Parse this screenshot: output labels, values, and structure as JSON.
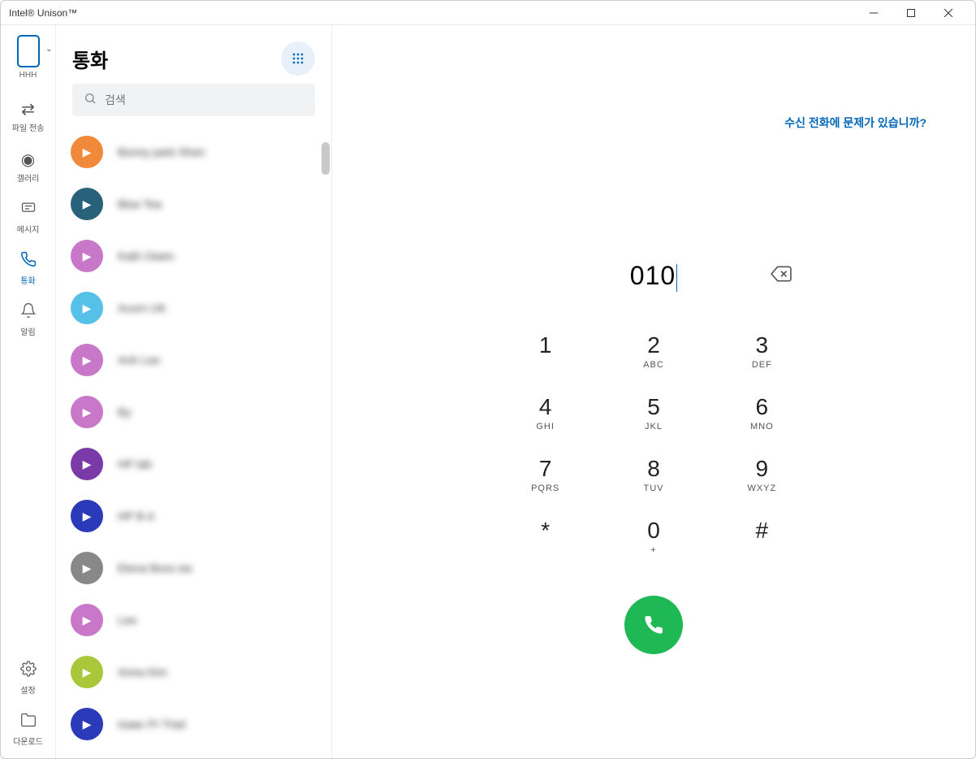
{
  "window": {
    "title": "Intel® Unison™"
  },
  "nav": {
    "device_label": "HHH",
    "items": [
      {
        "id": "file",
        "label": "파일 전송"
      },
      {
        "id": "gallery",
        "label": "갤러리"
      },
      {
        "id": "messages",
        "label": "메시지"
      },
      {
        "id": "calls",
        "label": "통화"
      },
      {
        "id": "notifications",
        "label": "알림"
      }
    ],
    "bottom": [
      {
        "id": "settings",
        "label": "설정"
      },
      {
        "id": "downloads",
        "label": "다운로드"
      }
    ],
    "active": "calls"
  },
  "contacts": {
    "title": "통화",
    "search_placeholder": "검색",
    "list": [
      {
        "name": "Bonny park Shen",
        "color": "#f08a3a"
      },
      {
        "name": "Blue Tea",
        "color": "#28627a"
      },
      {
        "name": "Kath Owen",
        "color": "#c978c9"
      },
      {
        "name": "Acorn UK",
        "color": "#55c0e8"
      },
      {
        "name": "Anh Lee",
        "color": "#c978c9"
      },
      {
        "name": "By",
        "color": "#c978c9"
      },
      {
        "name": "HP lab",
        "color": "#7a3aa8"
      },
      {
        "name": "HP B d",
        "color": "#2a3ab8"
      },
      {
        "name": "Elena Bora via",
        "color": "#888888"
      },
      {
        "name": "Lee",
        "color": "#c978c9"
      },
      {
        "name": "Anna Kim",
        "color": "#a8c83a"
      },
      {
        "name": "Isaac Pr Trad",
        "color": "#2a3ab8"
      }
    ]
  },
  "dialer": {
    "help_link": "수신 전화에 문제가 있습니까?",
    "entered_number": "010",
    "keys": [
      {
        "digit": "1",
        "letters": ""
      },
      {
        "digit": "2",
        "letters": "ABC"
      },
      {
        "digit": "3",
        "letters": "DEF"
      },
      {
        "digit": "4",
        "letters": "GHI"
      },
      {
        "digit": "5",
        "letters": "JKL"
      },
      {
        "digit": "6",
        "letters": "MNO"
      },
      {
        "digit": "7",
        "letters": "PQRS"
      },
      {
        "digit": "8",
        "letters": "TUV"
      },
      {
        "digit": "9",
        "letters": "WXYZ"
      },
      {
        "digit": "*",
        "letters": ""
      },
      {
        "digit": "0",
        "letters": "+"
      },
      {
        "digit": "#",
        "letters": ""
      }
    ]
  }
}
